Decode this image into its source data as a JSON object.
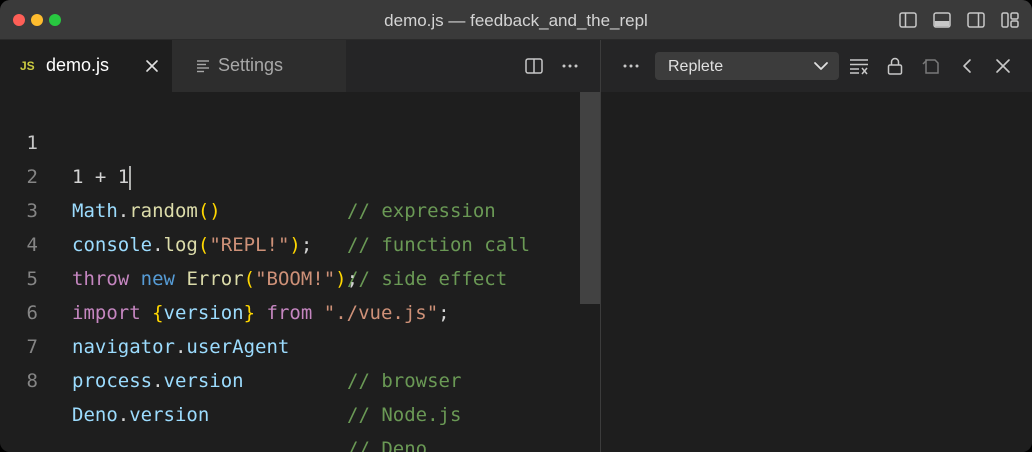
{
  "window": {
    "title": "demo.js — feedback_and_the_repl"
  },
  "tabs": [
    {
      "label": "demo.js",
      "badge": "JS",
      "active": true
    },
    {
      "label": "Settings",
      "active": false
    }
  ],
  "panel": {
    "dropdown_value": "Replete"
  },
  "editor": {
    "lines": [
      {
        "number": "1",
        "code": "1 + 1",
        "comment": "// expression"
      },
      {
        "number": "2",
        "code": "Math.random()",
        "comment": "// function call"
      },
      {
        "number": "3",
        "code": "console.log(\"REPL!\");",
        "comment": "// side effect"
      },
      {
        "number": "4",
        "code": "throw new Error(\"BOOM!\");",
        "comment": ""
      },
      {
        "number": "5",
        "code": "import {version} from \"./vue.js\";",
        "comment": ""
      },
      {
        "number": "6",
        "code": "navigator.userAgent",
        "comment": "// browser"
      },
      {
        "number": "7",
        "code": "process.version",
        "comment": "// Node.js"
      },
      {
        "number": "8",
        "code": "Deno.version",
        "comment": "// Deno"
      }
    ]
  },
  "colors": {
    "background": "#1e1e1e",
    "comment": "#6a9955",
    "keyword": "#c586c0",
    "variable": "#9cdcfe",
    "function": "#dcdcaa",
    "string": "#ce9178"
  }
}
